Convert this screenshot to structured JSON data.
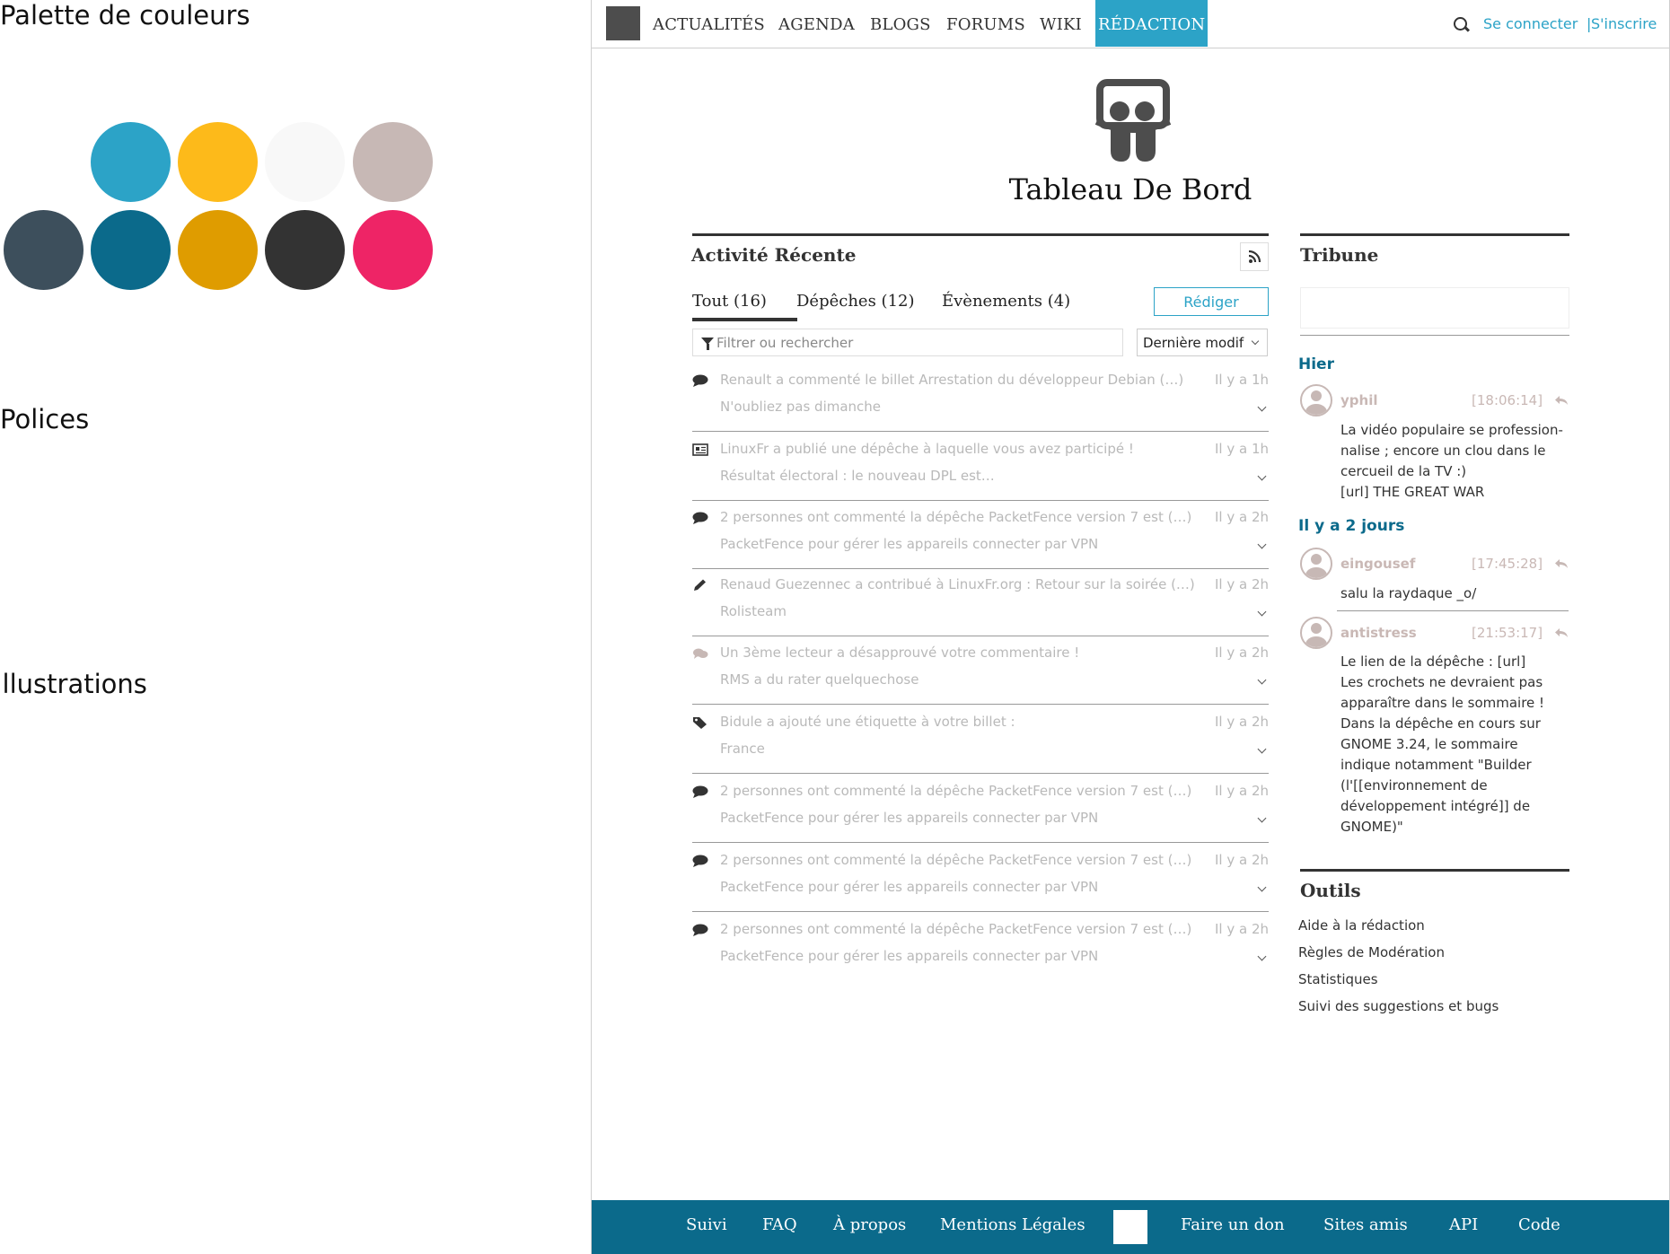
{
  "guide": {
    "palette_title": "Palette de couleurs",
    "fonts_title": "Polices",
    "illustrations_title": "Illustrations",
    "palette": [
      "#2ca3c7",
      "#fdba1a",
      "#f8f8f8",
      "#c7b8b5",
      "#3d4f5c",
      "#0b6a8b",
      "#df9c00",
      "#333333",
      "#ee2466"
    ]
  },
  "nav": {
    "items": [
      "ACTUALITÉS",
      "AGENDA",
      "BLOGS",
      "FORUMS",
      "WIKI",
      "RÉDACTION"
    ],
    "active": "RÉDACTION",
    "login": "Se connecter",
    "separator": "|",
    "signup": "S'inscrire"
  },
  "page_title": "Tableau De Bord",
  "activity": {
    "title": "Activité Récente",
    "tabs": [
      "Tout (16)",
      "Dépêches (12)",
      "Évènements (4)"
    ],
    "write_button": "Rédiger",
    "filter_placeholder": "Filtrer ou rechercher",
    "sort_value": "Dernière modif",
    "items": [
      {
        "icon": "comment-icon",
        "line1": "Renault a commenté le billet  Arrestation du développeur Debian (…)",
        "line2": "N'oubliez pas dimanche",
        "time": "Il y a 1h"
      },
      {
        "icon": "newspaper-icon",
        "line1": "LinuxFr a publié une dépêche à laquelle vous avez participé !",
        "line2": "Résultat électoral : le nouveau DPL est…",
        "time": "Il y a 1h"
      },
      {
        "icon": "comment-icon",
        "line1": "2 personnes ont commenté la dépêche PacketFence version 7 est (…)",
        "line2": "PacketFence pour gérer les appareils connecter par VPN",
        "time": "Il y a 2h"
      },
      {
        "icon": "pencil-icon",
        "line1": "Renaud Guezennec a contribué à LinuxFr.org : Retour sur la soirée (…)",
        "line2": "Rolisteam",
        "time": "Il y a 2h"
      },
      {
        "icon": "comments-icon",
        "line1": "Un 3ème lecteur a désapprouvé votre commentaire !",
        "line2": "RMS a du rater quelquechose",
        "time": "Il y a 2h"
      },
      {
        "icon": "tag-icon",
        "line1": "Bidule a ajouté une étiquette à votre billet :",
        "line2": "France",
        "time": "Il y a 2h"
      },
      {
        "icon": "comment-icon",
        "line1": "2 personnes ont commenté la dépêche PacketFence version 7 est (…)",
        "line2": "PacketFence pour gérer les appareils connecter par VPN",
        "time": "Il y a 2h"
      },
      {
        "icon": "comment-icon",
        "line1": "2 personnes ont commenté la dépêche PacketFence version 7 est (…)",
        "line2": "PacketFence pour gérer les appareils connecter par VPN",
        "time": "Il y a 2h"
      },
      {
        "icon": "comment-icon",
        "line1": "2 personnes ont commenté la dépêche PacketFence version 7 est (…)",
        "line2": "PacketFence pour gérer les appareils connecter par VPN",
        "time": "Il y a 2h"
      }
    ]
  },
  "tribune": {
    "title": "Tribune",
    "days": [
      {
        "label": "Hier",
        "messages": [
          {
            "user": "yphil",
            "time": "[18:06:14]",
            "lines": [
              "La vidéo populaire se profession-",
              "nalise ; encore un clou dans le",
              "cercueil de la TV :)",
              "[url] THE GREAT WAR"
            ]
          }
        ]
      },
      {
        "label": "Il y a 2 jours",
        "messages": [
          {
            "user": "eingousef",
            "time": "[17:45:28]",
            "lines": [
              "salu la raydaque _o/"
            ]
          },
          {
            "user": "antistress",
            "time": "[21:53:17]",
            "lines": [
              "Le lien de la dépêche : [url]",
              "Les crochets ne devraient pas",
              "apparaître dans le sommaire !",
              "Dans la dépêche en cours sur",
              "GNOME 3.24, le sommaire",
              "indique notamment \"Builder",
              "(l'[[environnement de",
              "développement intégré]] de",
              "GNOME)\""
            ]
          }
        ]
      }
    ]
  },
  "tools": {
    "title": "Outils",
    "links": [
      "Aide à la rédaction",
      "Règles de Modération",
      "Statistiques",
      "Suivi des suggestions et bugs"
    ]
  },
  "footer": {
    "left": [
      "Suivi",
      "FAQ",
      "À propos",
      "Mentions Légales"
    ],
    "right": [
      "Faire un don",
      "Sites amis",
      "API",
      "Code"
    ]
  }
}
